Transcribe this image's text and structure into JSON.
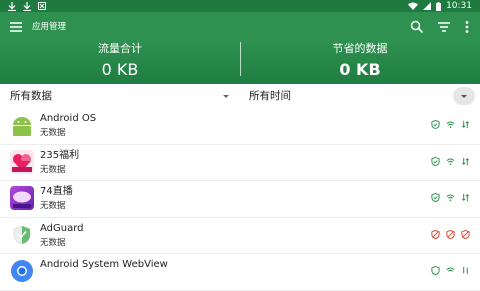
{
  "status_bar": {
    "time": "10:31"
  },
  "toolbar": {
    "title": "应用管理"
  },
  "stats": {
    "left": {
      "label": "流量合计",
      "value": "0 KB"
    },
    "right": {
      "label": "节省的数据",
      "value": "0 KB"
    }
  },
  "filters": {
    "data_filter": "所有数据",
    "time_filter": "所有时间"
  },
  "apps": [
    {
      "name": "Android OS",
      "sub": "无数据",
      "icon": "android-icon",
      "status": "green"
    },
    {
      "name": "235福利",
      "sub": "无数据",
      "icon": "235-app-icon",
      "status": "green"
    },
    {
      "name": "74直播",
      "sub": "无数据",
      "icon": "74-live-icon",
      "status": "green"
    },
    {
      "name": "AdGuard",
      "sub": "无数据",
      "icon": "adguard-icon",
      "status": "red"
    },
    {
      "name": "Android System WebView",
      "sub": "",
      "icon": "webview-icon",
      "status": "green"
    }
  ],
  "colors": {
    "primary": "#2e9150",
    "status_bar": "#1e7a3f",
    "ok": "#2e9150",
    "blocked": "#d9442b"
  }
}
